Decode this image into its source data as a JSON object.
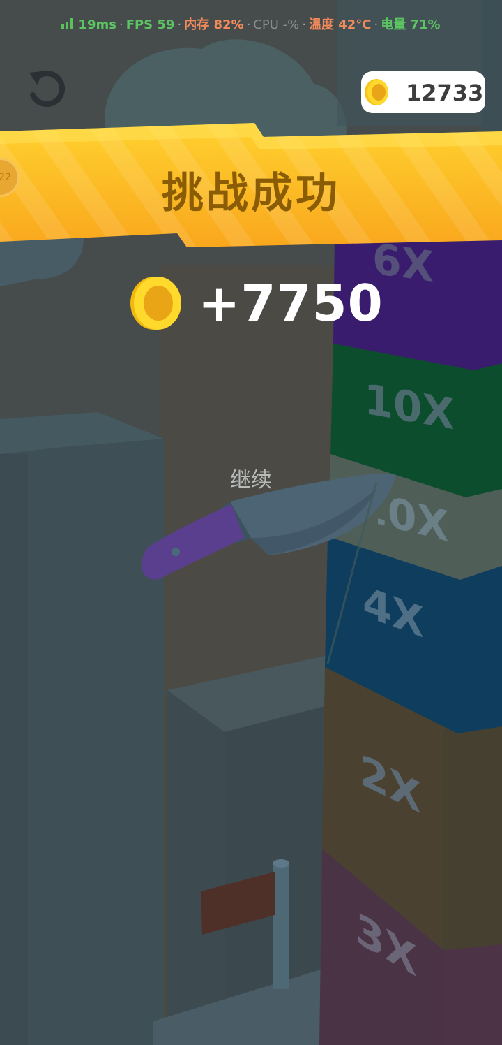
{
  "status_bar": {
    "ping": "19ms",
    "fps": "FPS 59",
    "memory": "内存 82%",
    "cpu": "CPU -%",
    "temperature": "温度 42°C",
    "battery": "电量 71%",
    "separator": "·"
  },
  "hud": {
    "coin_balance": "12733",
    "restart_icon": "restart-icon",
    "coin_icon": "coin-icon"
  },
  "banner": {
    "title": "挑战成功",
    "level_badge": "22"
  },
  "reward": {
    "amount": "+7750",
    "coin_icon": "coin-icon"
  },
  "continue_button": {
    "label": "继续"
  },
  "tower": {
    "blocks": [
      {
        "label": "6X",
        "color": "#3a1c6e"
      },
      {
        "label": "10X",
        "color": "#0b4d2d"
      },
      {
        "label": "10X",
        "color": "#4f5f58"
      },
      {
        "label": "4X",
        "color": "#0e3d5e"
      },
      {
        "label": "2X",
        "color": "#4b4130"
      },
      {
        "label": "3X",
        "color": "#4d3346"
      }
    ]
  },
  "colors": {
    "banner": "#fbb526",
    "banner_text": "#8a5c06",
    "coin": "#f7c515",
    "knife_handle": "#5a3f8f",
    "knife_blade": "#4c6473"
  }
}
